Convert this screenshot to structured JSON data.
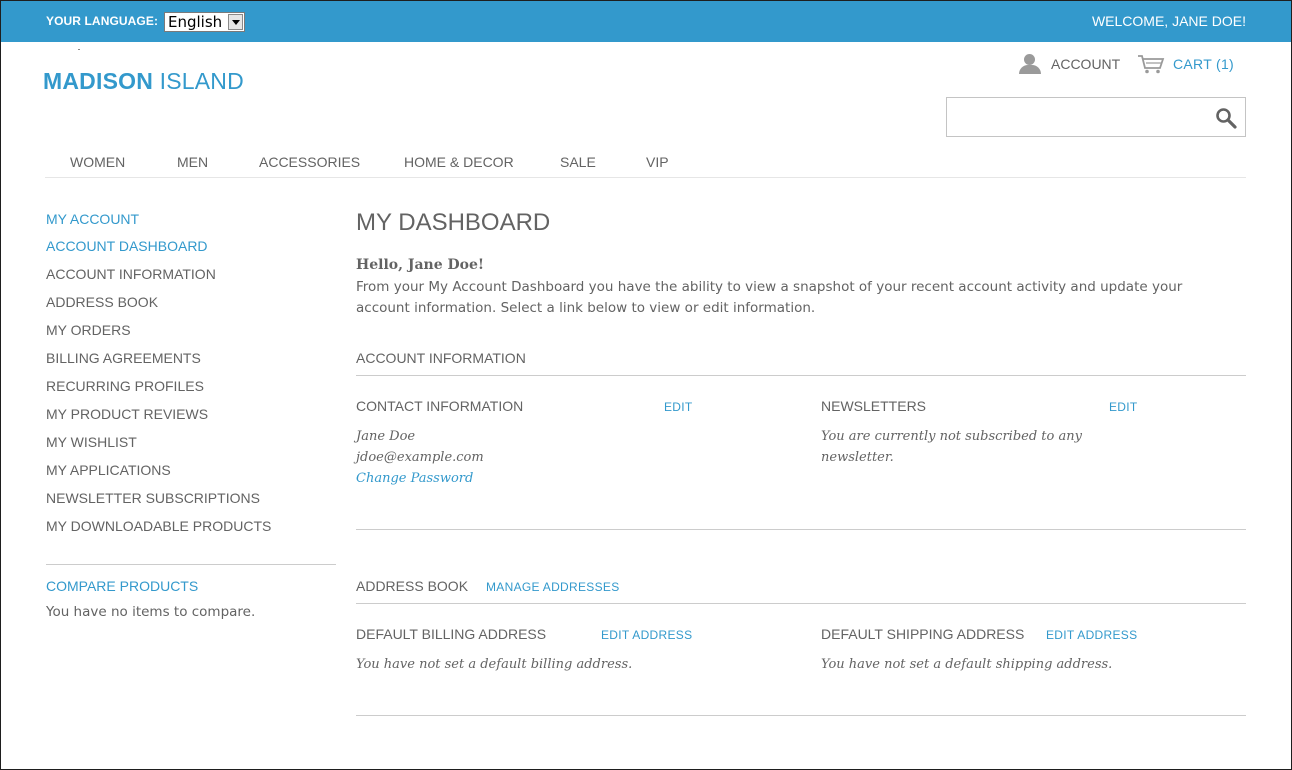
{
  "topbar": {
    "language_label": "YOUR LANGUAGE:",
    "language_selected": "English",
    "welcome": "WELCOME, JANE DOE!",
    "color": "#3399cc"
  },
  "header": {
    "logo_bold": "MADISON",
    "logo_light": "ISLAND",
    "account_label": "ACCOUNT",
    "cart_label": "CART (1)",
    "search_placeholder": ""
  },
  "nav": {
    "items": [
      "WOMEN",
      "MEN",
      "ACCESSORIES",
      "HOME & DECOR",
      "SALE",
      "VIP"
    ]
  },
  "sidebar": {
    "title": "MY ACCOUNT",
    "items": [
      "ACCOUNT DASHBOARD",
      "ACCOUNT INFORMATION",
      "ADDRESS BOOK",
      "MY ORDERS",
      "BILLING AGREEMENTS",
      "RECURRING PROFILES",
      "MY PRODUCT REVIEWS",
      "MY WISHLIST",
      "MY APPLICATIONS",
      "NEWSLETTER SUBSCRIPTIONS",
      "MY DOWNLOADABLE PRODUCTS"
    ],
    "active_index": 0,
    "compare_title": "COMPARE PRODUCTS",
    "compare_text": "You have no items to compare."
  },
  "main": {
    "title": "MY DASHBOARD",
    "hello": "Hello, Jane Doe!",
    "intro": "From your My Account Dashboard you have the ability to view a snapshot of your recent account activity and update your account information. Select a link below to view or edit information.",
    "account_info": {
      "title": "ACCOUNT INFORMATION",
      "contact": {
        "title": "CONTACT INFORMATION",
        "edit": "EDIT",
        "name": "Jane Doe",
        "email": "jdoe@example.com",
        "change_password": "Change Password"
      },
      "newsletters": {
        "title": "NEWSLETTERS",
        "edit": "EDIT",
        "line1": "You are currently not subscribed to any",
        "line2": "newsletter."
      }
    },
    "address_book": {
      "title": "ADDRESS BOOK",
      "manage": "MANAGE ADDRESSES",
      "billing": {
        "title": "DEFAULT BILLING ADDRESS",
        "edit": "EDIT ADDRESS",
        "text": "You have not set a default billing address."
      },
      "shipping": {
        "title": "DEFAULT SHIPPING ADDRESS",
        "edit": "EDIT ADDRESS",
        "text": "You have not set a default shipping address."
      }
    }
  }
}
